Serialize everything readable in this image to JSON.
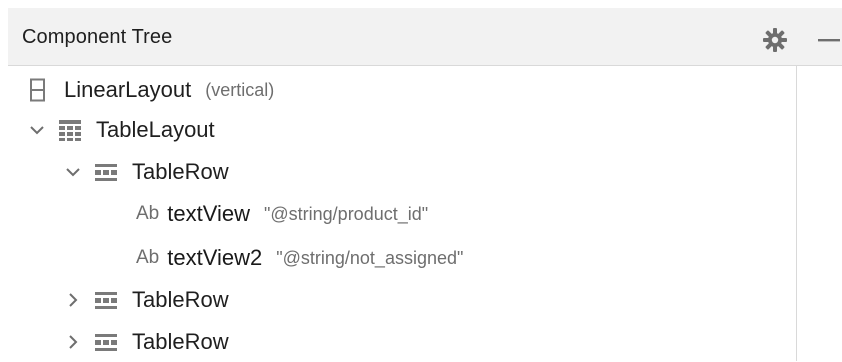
{
  "panel": {
    "title": "Component Tree",
    "header_icons": [
      "gear-icon",
      "minimize-icon"
    ]
  },
  "tree": {
    "nodes": [
      {
        "label": "LinearLayout",
        "detail": "(vertical)",
        "icon": "linear-layout-icon"
      },
      {
        "label": "TableLayout",
        "detail": "",
        "icon": "table-layout-icon",
        "expanded": true
      },
      {
        "label": "TableRow",
        "detail": "",
        "icon": "table-row-icon",
        "expanded": true
      },
      {
        "prefix": "Ab",
        "label": "textView",
        "detail": "\"@string/product_id\"",
        "icon": "text-view-icon"
      },
      {
        "prefix": "Ab",
        "label": "textView2",
        "detail": "\"@string/not_assigned\"",
        "icon": "text-view-icon"
      },
      {
        "label": "TableRow",
        "detail": "",
        "icon": "table-row-icon",
        "expanded": false
      },
      {
        "label": "TableRow",
        "detail": "",
        "icon": "table-row-icon",
        "expanded": false
      }
    ]
  },
  "colors": {
    "header_bg": "#f2f2f2",
    "icon_gray": "#7a7a7a",
    "secondary_text": "#6e6e6e"
  }
}
